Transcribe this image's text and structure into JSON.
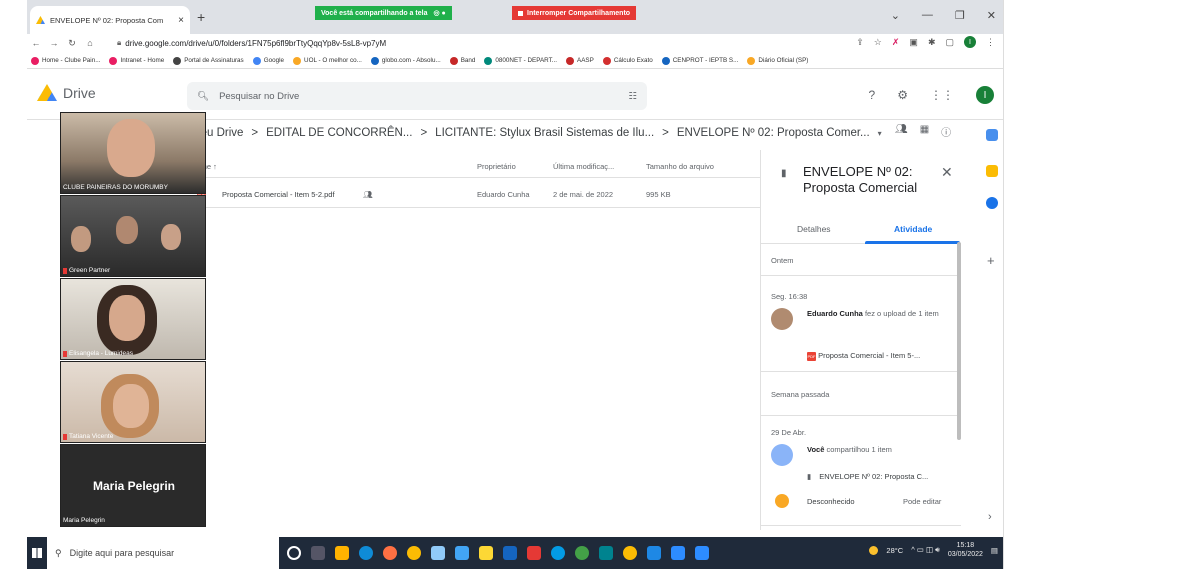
{
  "browser": {
    "tab_title": "ENVELOPE Nº 02: Proposta Com",
    "new_tab": "+",
    "share_banner": "Você está compartilhando a tela",
    "stop_share": "Interromper Compartilhamento",
    "url": "drive.google.com/drive/u/0/folders/1FN75p6fl9brTtyQqqYp8v-5sL8-vp7yM",
    "profile_initial": "I"
  },
  "bookmarks": [
    {
      "label": "Home - Clube Pain...",
      "color": "#e91e63"
    },
    {
      "label": "Intranet - Home",
      "color": "#e91e63"
    },
    {
      "label": "Portal de Assinaturas",
      "color": "#444444"
    },
    {
      "label": "Google",
      "color": "#4285f4"
    },
    {
      "label": "UOL - O melhor co...",
      "color": "#f9a825"
    },
    {
      "label": "globo.com - Absolu...",
      "color": "#1565c0"
    },
    {
      "label": "Band",
      "color": "#c62828"
    },
    {
      "label": "0800NET - DEPART...",
      "color": "#00897b"
    },
    {
      "label": "AASP",
      "color": "#c62828"
    },
    {
      "label": "Cálculo Exato",
      "color": "#d32f2f"
    },
    {
      "label": "CENPROT - IEPTB S...",
      "color": "#1565c0"
    },
    {
      "label": "Diário Oficial (SP)",
      "color": "#f9a825"
    }
  ],
  "drive": {
    "app_name": "Drive",
    "search_placeholder": "Pesquisar no Drive",
    "user_initial": "I"
  },
  "breadcrumb": [
    "Meu Drive",
    "EDITAL DE CONCORRÊN...",
    "LICITANTE: Stylux Brasil Sistemas de Ilu...",
    "ENVELOPE Nº 02: Proposta Comer..."
  ],
  "list": {
    "headers": {
      "name": "Nome ↑",
      "owner": "Proprietário",
      "modified": "Última modificaç...",
      "size": "Tamanho do arquivo"
    },
    "files": [
      {
        "name": "Proposta Comercial - Item 5-2.pdf",
        "owner": "Eduardo Cunha",
        "modified": "2 de mai. de 2022",
        "size": "995 KB"
      }
    ]
  },
  "panel": {
    "title": "ENVELOPE Nº 02: Proposta Comercial",
    "tab_details": "Detalhes",
    "tab_activity": "Atividade",
    "group_yesterday": "Ontem",
    "time1": "Seg. 16:38",
    "actor1": "Eduardo Cunha",
    "action1": "fez o upload de 1 item",
    "file1": "Proposta Comercial - Item 5-...",
    "group_lastweek": "Semana passada",
    "time2": "29 De Abr.",
    "actor2": "Você",
    "action2": "compartilhou 1 item",
    "folder2": "ENVELOPE Nº 02: Proposta C...",
    "unknown": "Desconhecido",
    "can_edit": "Pode editar"
  },
  "video_tiles": [
    {
      "name": "CLUBE PAINEIRAS DO MORUMBY"
    },
    {
      "name": "Green Partner"
    },
    {
      "name": "Elisangela - Lumideas"
    },
    {
      "name": "Tatiana Vicente"
    },
    {
      "name": "Maria Pelegrin",
      "big_label": "Maria Pelegrin"
    }
  ],
  "taskbar": {
    "search_placeholder": "Digite aqui para pesquisar",
    "weather": "28°C",
    "time": "15:18",
    "date": "03/05/2022"
  }
}
